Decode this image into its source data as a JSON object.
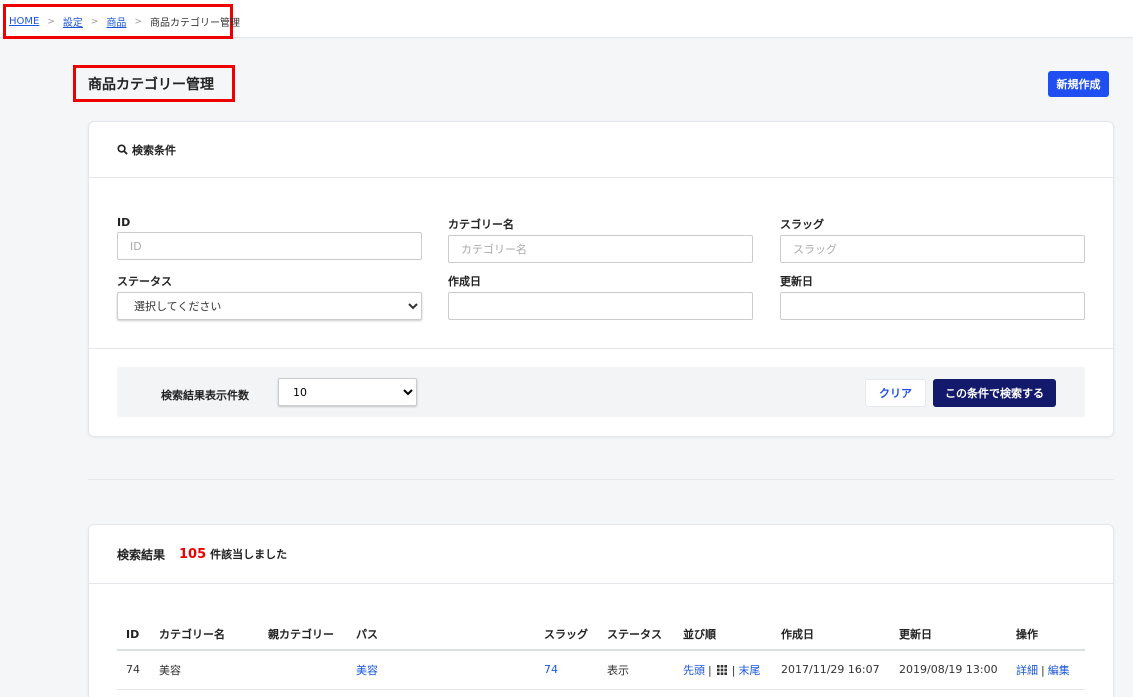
{
  "breadcrumb": {
    "items": [
      "HOME",
      "設定",
      "商品"
    ],
    "separator": ">",
    "current": "商品カテゴリー管理"
  },
  "page": {
    "title": "商品カテゴリー管理",
    "new_button": "新規作成"
  },
  "search": {
    "header": "検索条件",
    "header_icon": "search-icon",
    "fields": {
      "id": {
        "label": "ID",
        "placeholder": "ID"
      },
      "name": {
        "label": "カテゴリー名",
        "placeholder": "カテゴリー名"
      },
      "slug": {
        "label": "スラッグ",
        "placeholder": "スラッグ"
      },
      "status": {
        "label": "ステータス",
        "value": "選択してください"
      },
      "created": {
        "label": "作成日",
        "value": ""
      },
      "updated": {
        "label": "更新日",
        "value": ""
      }
    },
    "per_page_label": "検索結果表示件数",
    "per_page_value": "10",
    "clear_button": "クリア",
    "submit_button": "この条件で検索する"
  },
  "results": {
    "header": "検索結果",
    "count": "105",
    "count_suffix": "件該当しました",
    "columns": [
      "ID",
      "カテゴリー名",
      "親カテゴリー",
      "パス",
      "スラッグ",
      "ステータス",
      "並び順",
      "作成日",
      "更新日",
      "操作"
    ],
    "rows": [
      {
        "id": "74",
        "name": "美容",
        "parent": "",
        "path": "美容",
        "slug": "74",
        "status": "表示",
        "order_first": "先頭",
        "order_last": "末尾",
        "created": "2017/11/29 16:07",
        "updated": "2019/08/19 13:00",
        "action_detail": "詳細",
        "action_edit": "編集"
      }
    ]
  },
  "colors": {
    "accent": "#1f4ff0",
    "primary_dark": "#13196b",
    "highlight_red": "#ee0000",
    "link": "#1a56db"
  }
}
